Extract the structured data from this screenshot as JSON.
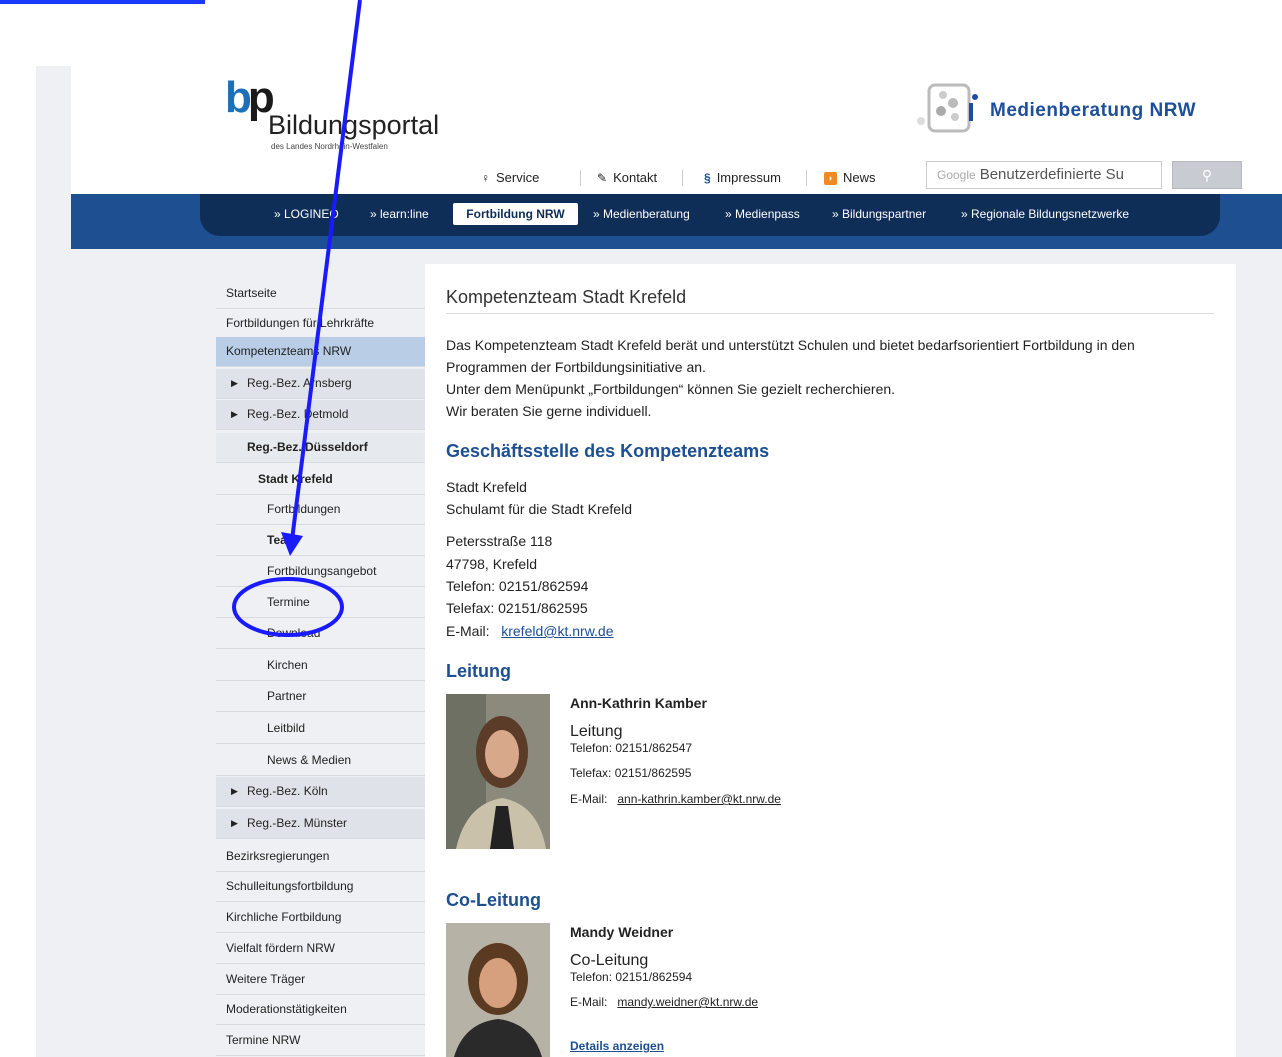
{
  "header": {
    "logo_bp": "bp",
    "logo_name": "Bildungsportal",
    "logo_sub": "des Landes Nordrhein-Westfalen",
    "partner_logo": "Medienberatung NRW",
    "service_links": [
      {
        "icon": "lightbulb-icon",
        "label": "Service"
      },
      {
        "icon": "pencil-icon",
        "label": "Kontakt"
      },
      {
        "icon": "paragraph-icon",
        "label": "Impressum"
      },
      {
        "icon": "rss-icon",
        "label": "News"
      }
    ],
    "search": {
      "brand": "Google",
      "placeholder": "Benutzerdefinierte Su",
      "button_icon": "search-icon"
    }
  },
  "nav": {
    "items": [
      "» LOGINEO",
      "» learn:line",
      "» Medienberatung",
      "» Medienpass",
      "» Bildungspartner",
      "» Regionale Bildungsnetzwerke"
    ],
    "active": "Fortbildung NRW"
  },
  "sidebar": {
    "items": [
      "Startseite",
      "Fortbildungen für Lehrkräfte",
      "Kompetenzteams NRW",
      "Reg.-Bez. Arnsberg",
      "Reg.-Bez. Detmold",
      "Reg.-Bez. Düsseldorf",
      "Stadt Krefeld",
      "Fortbildungen",
      "Team",
      "Fortbildungsangebot",
      "Termine",
      "Download",
      "Kirchen",
      "Partner",
      "Leitbild",
      "News & Medien",
      "Reg.-Bez. Köln",
      "Reg.-Bez. Münster",
      "Bezirksregierungen",
      "Schulleitungsfortbildung",
      "Kirchliche Fortbildung",
      "Vielfalt fördern NRW",
      "Weitere Träger",
      "Moderationstätigkeiten",
      "Termine NRW"
    ]
  },
  "content": {
    "title": "Kompetenzteam Stadt Krefeld",
    "intro": [
      "Das Kompetenzteam Stadt Krefeld berät und unterstützt Schulen und bietet bedarfsorientiert Fortbildung in den",
      "Programmen der Fortbildungsinitiative an.",
      "Unter dem Menüpunkt „Fortbildungen“ können Sie gezielt recherchieren.",
      "Wir beraten Sie gerne individuell."
    ],
    "office_heading": "Geschäftsstelle des Kompetenzteams",
    "office_lines": [
      "Stadt Krefeld",
      "Schulamt für die Stadt Krefeld"
    ],
    "address_lines": [
      "Petersstraße 118",
      "47798, Krefeld",
      "Telefon: 02151/862594",
      "Telefax: 02151/862595"
    ],
    "email_label": "E-Mail:",
    "email": "krefeld@kt.nrw.de",
    "leitung_heading": "Leitung",
    "leitung": {
      "name": "Ann-Kathrin Kamber",
      "role": "Leitung",
      "telefon": "Telefon:   02151/862547",
      "telefax": "Telefax:   02151/862595",
      "email_label": "E-Mail:",
      "email": "ann-kathrin.kamber@kt.nrw.de"
    },
    "coleitung_heading": "Co-Leitung",
    "coleitung": {
      "name": "Mandy Weidner",
      "role": "Co-Leitung",
      "telefon": "Telefon:   02151/862594",
      "email_label": "E-Mail:",
      "email": "mandy.weidner@kt.nrw.de"
    },
    "details_link": "Details anzeigen"
  },
  "colors": {
    "nav_blue": "#1d4f91",
    "nav_dark": "#0f2e57",
    "sidebar_active": "#b9cde6",
    "annotation": "#1a1aff"
  }
}
